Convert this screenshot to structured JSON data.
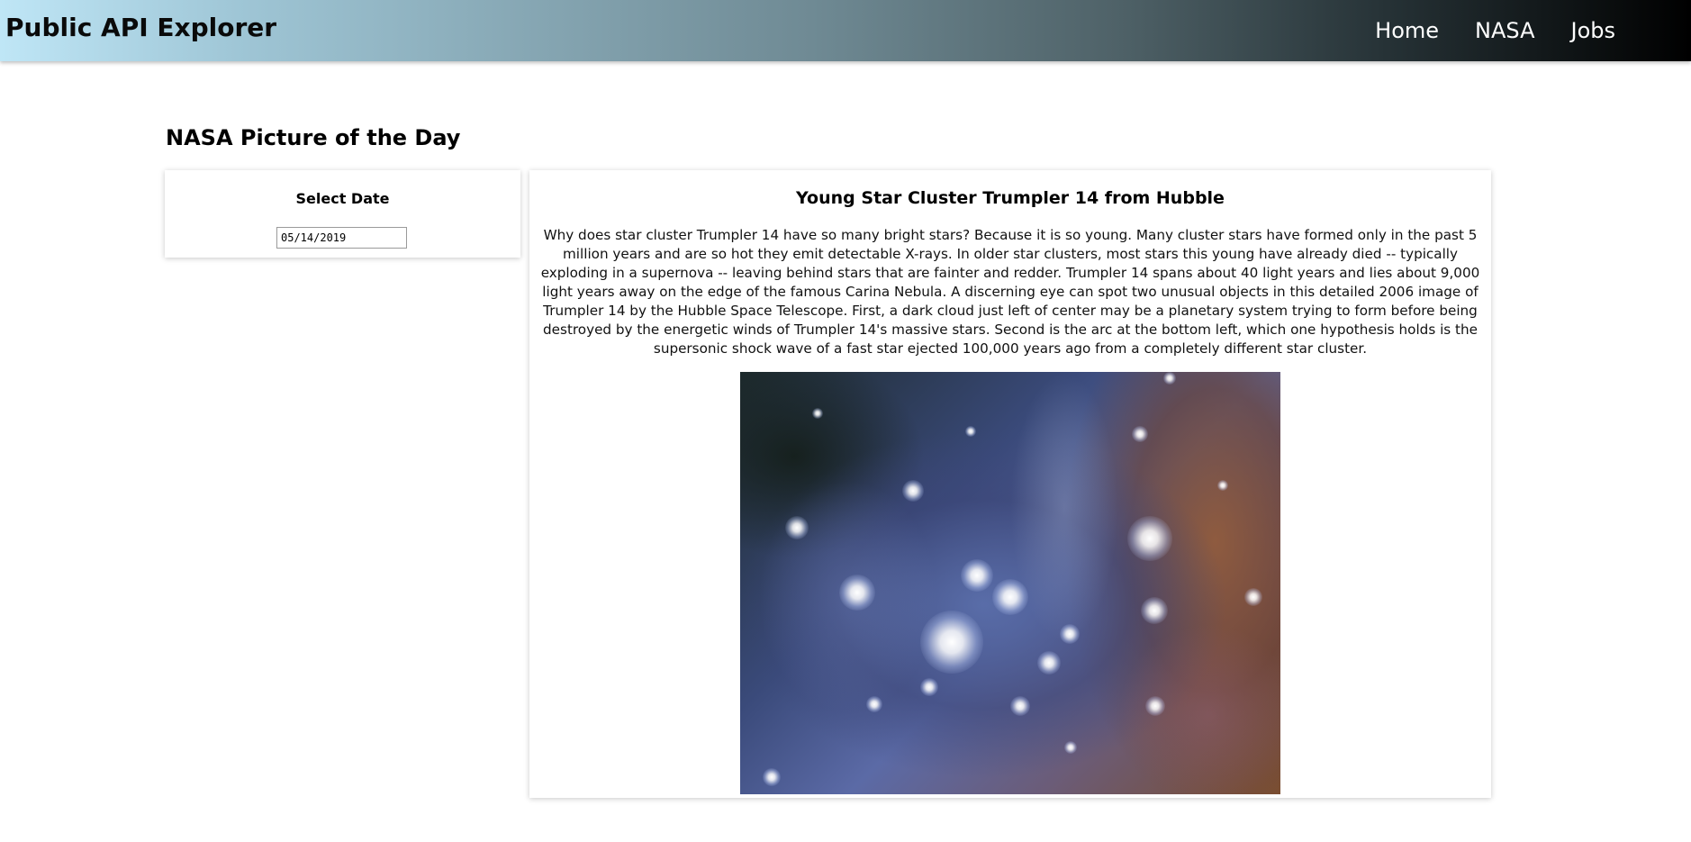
{
  "navbar": {
    "brand": "Public API Explorer",
    "links": [
      "Home",
      "NASA",
      "Jobs"
    ]
  },
  "page": {
    "title": "NASA Picture of the Day"
  },
  "date_selector": {
    "label": "Select Date",
    "value": "05/14/2019"
  },
  "apod": {
    "title": "Young Star Cluster Trumpler 14 from Hubble",
    "description": "Why does star cluster Trumpler 14 have so many bright stars? Because it is so young. Many cluster stars have formed only in the past 5 million years and are so hot they emit detectable X-rays. In older star clusters, most stars this young have already died -- typically exploding in a supernova -- leaving behind stars that are fainter and redder. Trumpler 14 spans about 40 light years and lies about 9,000 light years away on the edge of the famous Carina Nebula. A discerning eye can spot two unusual objects in this detailed 2006 image of Trumpler 14 by the Hubble Space Telescope. First, a dark cloud just left of center may be a planetary system trying to form before being destroyed by the energetic winds of Trumpler 14's massive stars. Second is the arc at the bottom left, which one hypothesis holds is the supersonic shock wave of a fast star ejected 100,000 years ago from a completely different star cluster.",
    "image_alt": "Star cluster Trumpler 14"
  },
  "colors": {
    "navbar_gradient_start": "#bfe6f6",
    "navbar_gradient_end": "#000000",
    "nav_link": "#ffffff"
  }
}
